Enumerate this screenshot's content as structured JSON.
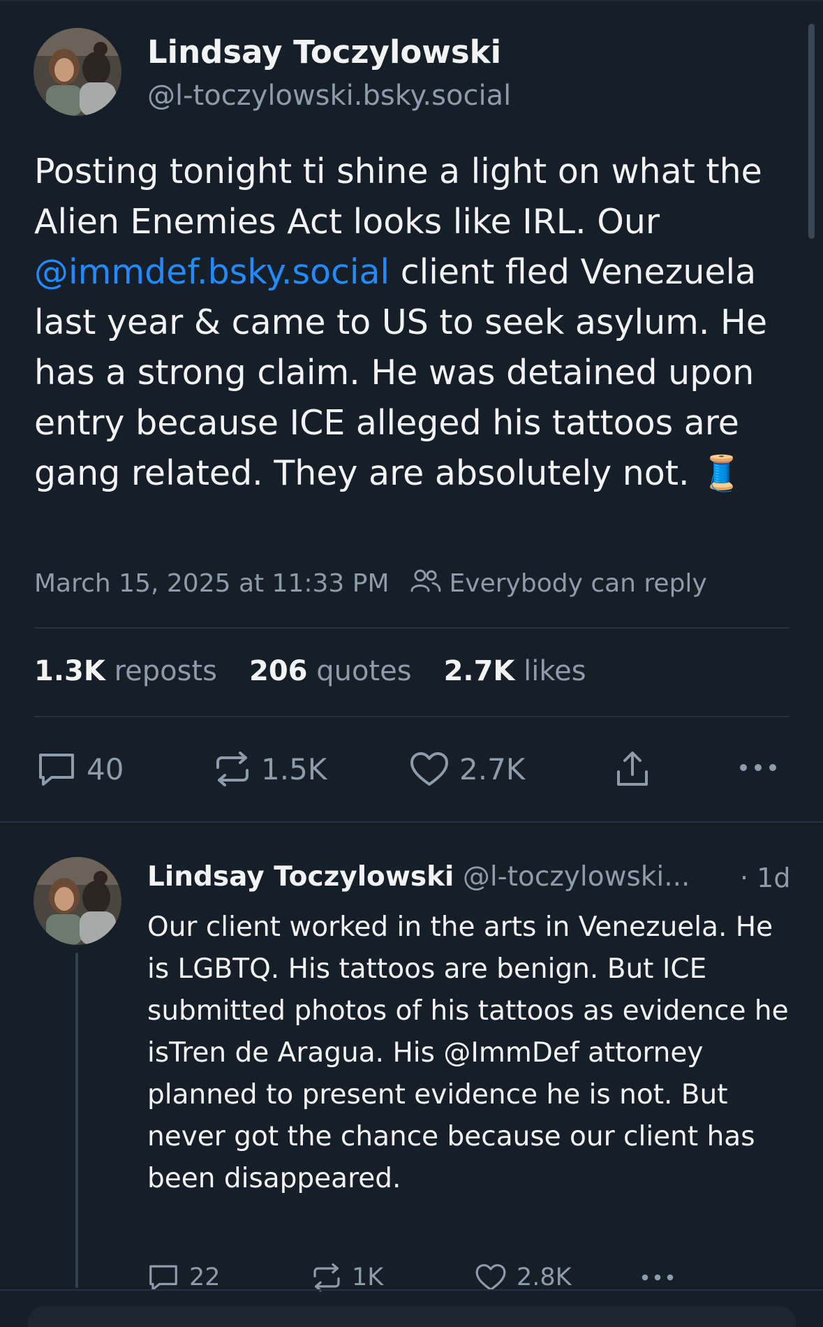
{
  "main_post": {
    "author_name": "Lindsay Toczylowski",
    "author_handle": "@l-toczylowski.bsky.social",
    "text_1": "Posting tonight ti shine a light on what the Alien Enemies Act looks like IRL. Our ",
    "mention": "@immdef.bsky.social",
    "text_2": " client fled Venezuela last year & came to US to seek asylum. He has a strong claim. He was detained upon entry because ICE alleged his tattoos are gang related. They are absolutely not. ",
    "emoji": "🧵",
    "timestamp": "March 15, 2025 at 11:33 PM",
    "reply_setting": "Everybody can reply",
    "stats": {
      "reposts_count": "1.3K",
      "reposts_label": "reposts",
      "quotes_count": "206",
      "quotes_label": "quotes",
      "likes_count": "2.7K",
      "likes_label": "likes"
    },
    "actions": {
      "replies": "40",
      "reposts": "1.5K",
      "likes": "2.7K"
    }
  },
  "reply_post": {
    "author_name": "Lindsay Toczylowski",
    "author_handle": "@l-toczylowski...",
    "age": "· 1d",
    "text": "Our client worked in the arts in Venezuela. He is LGBTQ. His tattoos are benign. But ICE submitted photos of his tattoos as evidence he isTren de Aragua. His @ImmDef attorney planned to present evidence he is not. But never got the chance because our client has been disappeared.",
    "actions": {
      "replies": "22",
      "reposts": "1K",
      "likes": "2.8K"
    }
  },
  "icons": [
    "reply-icon",
    "repost-icon",
    "like-icon",
    "share-icon",
    "more-icon",
    "people-icon",
    "thread-emoji"
  ],
  "colors": {
    "background": "#161e27",
    "text": "#f1f3f5",
    "muted": "#8d9baa",
    "link": "#208bfe",
    "divider": "#263240"
  }
}
